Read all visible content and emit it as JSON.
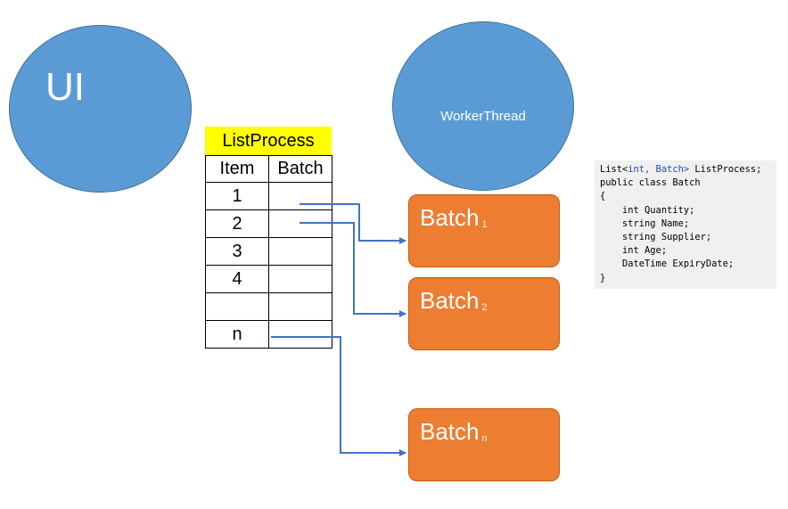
{
  "ui": {
    "label": "UI"
  },
  "worker": {
    "label": "WorkerThread"
  },
  "list": {
    "title": "ListProcess",
    "headers": [
      "Item",
      "Batch"
    ],
    "rows": [
      {
        "item": "1",
        "batch": ""
      },
      {
        "item": "2",
        "batch": ""
      },
      {
        "item": "3",
        "batch": ""
      },
      {
        "item": "4",
        "batch": ""
      },
      {
        "item": "",
        "batch": ""
      },
      {
        "item": "n",
        "batch": ""
      }
    ]
  },
  "batches": [
    {
      "name": "Batch",
      "sub": "1"
    },
    {
      "name": "Batch",
      "sub": "2"
    },
    {
      "name": "Batch",
      "sub": "n"
    }
  ],
  "code": {
    "line1_a": "List<",
    "line1_b": "int, Batch>",
    "line1_c": " ListProcess;",
    "line2": "public class Batch",
    "line3": "{",
    "line4": "    int Quantity;",
    "line5": "    string Name;",
    "line6": "    string Supplier;",
    "line7": "    int Age;",
    "line8": "    DateTime ExpiryDate;",
    "line9": "}"
  },
  "colors": {
    "circle": "#5b9bd5",
    "batch": "#ed7d31",
    "title_bg": "#ffff00",
    "arrow": "#4472c4"
  }
}
